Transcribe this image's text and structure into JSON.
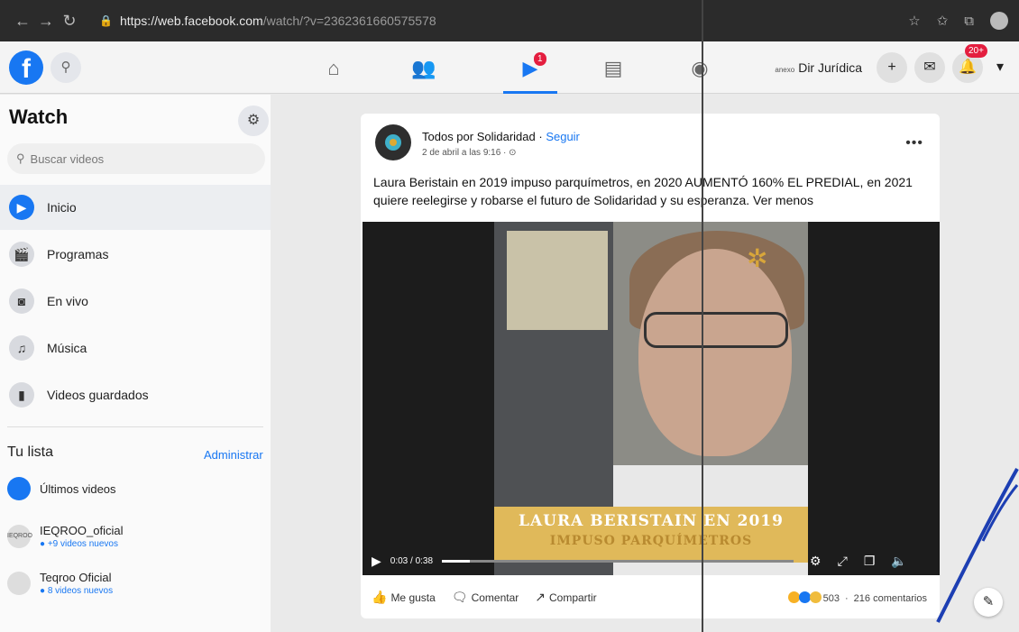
{
  "browser": {
    "url_host": "https://web.facebook.com",
    "url_path": "/watch/?v=2362361660575578"
  },
  "header": {
    "page_name": "Dir Jurídica",
    "page_tiny": "anexo",
    "watch_badge": "1",
    "notifications_badge": "20+"
  },
  "sidebar": {
    "title": "Watch",
    "search_placeholder": "Buscar videos",
    "items": [
      {
        "label": "Inicio",
        "icon": "play-icon"
      },
      {
        "label": "Programas",
        "icon": "clapper-icon"
      },
      {
        "label": "En vivo",
        "icon": "live-camera-icon"
      },
      {
        "label": "Música",
        "icon": "music-note-icon"
      },
      {
        "label": "Videos guardados",
        "icon": "bookmark-icon"
      }
    ],
    "list_title": "Tu lista",
    "manage_label": "Administrar",
    "list": [
      {
        "name": "Últimos videos",
        "sub": ""
      },
      {
        "name": "IEQROO_oficial",
        "sub": "+9 videos nuevos"
      },
      {
        "name": "Teqroo Oficial",
        "sub": "8 videos nuevos"
      }
    ]
  },
  "post": {
    "author": "Todos por Solidaridad",
    "separator": " · ",
    "follow": "Seguir",
    "time": "2 de abril a las 9:16 · ⊙",
    "text": "Laura Beristain en 2019 impuso parquímetros, en 2020 AUMENTÓ 160% EL PREDIAL, en 2021 quiere reelegirse y robarse el futuro de Solidaridad y su esperanza. Ver menos",
    "video": {
      "caption_line1": "LAURA BERISTAIN EN 2019",
      "caption_line2": "IMPUSO PARQUÍMETROS",
      "time": "0:03 / 0:38",
      "progress": 0.08
    },
    "actions": {
      "like": "Me gusta",
      "comment": "Comentar",
      "share": "Compartir"
    },
    "reactions_count": "503",
    "comments": "216 comentarios"
  }
}
